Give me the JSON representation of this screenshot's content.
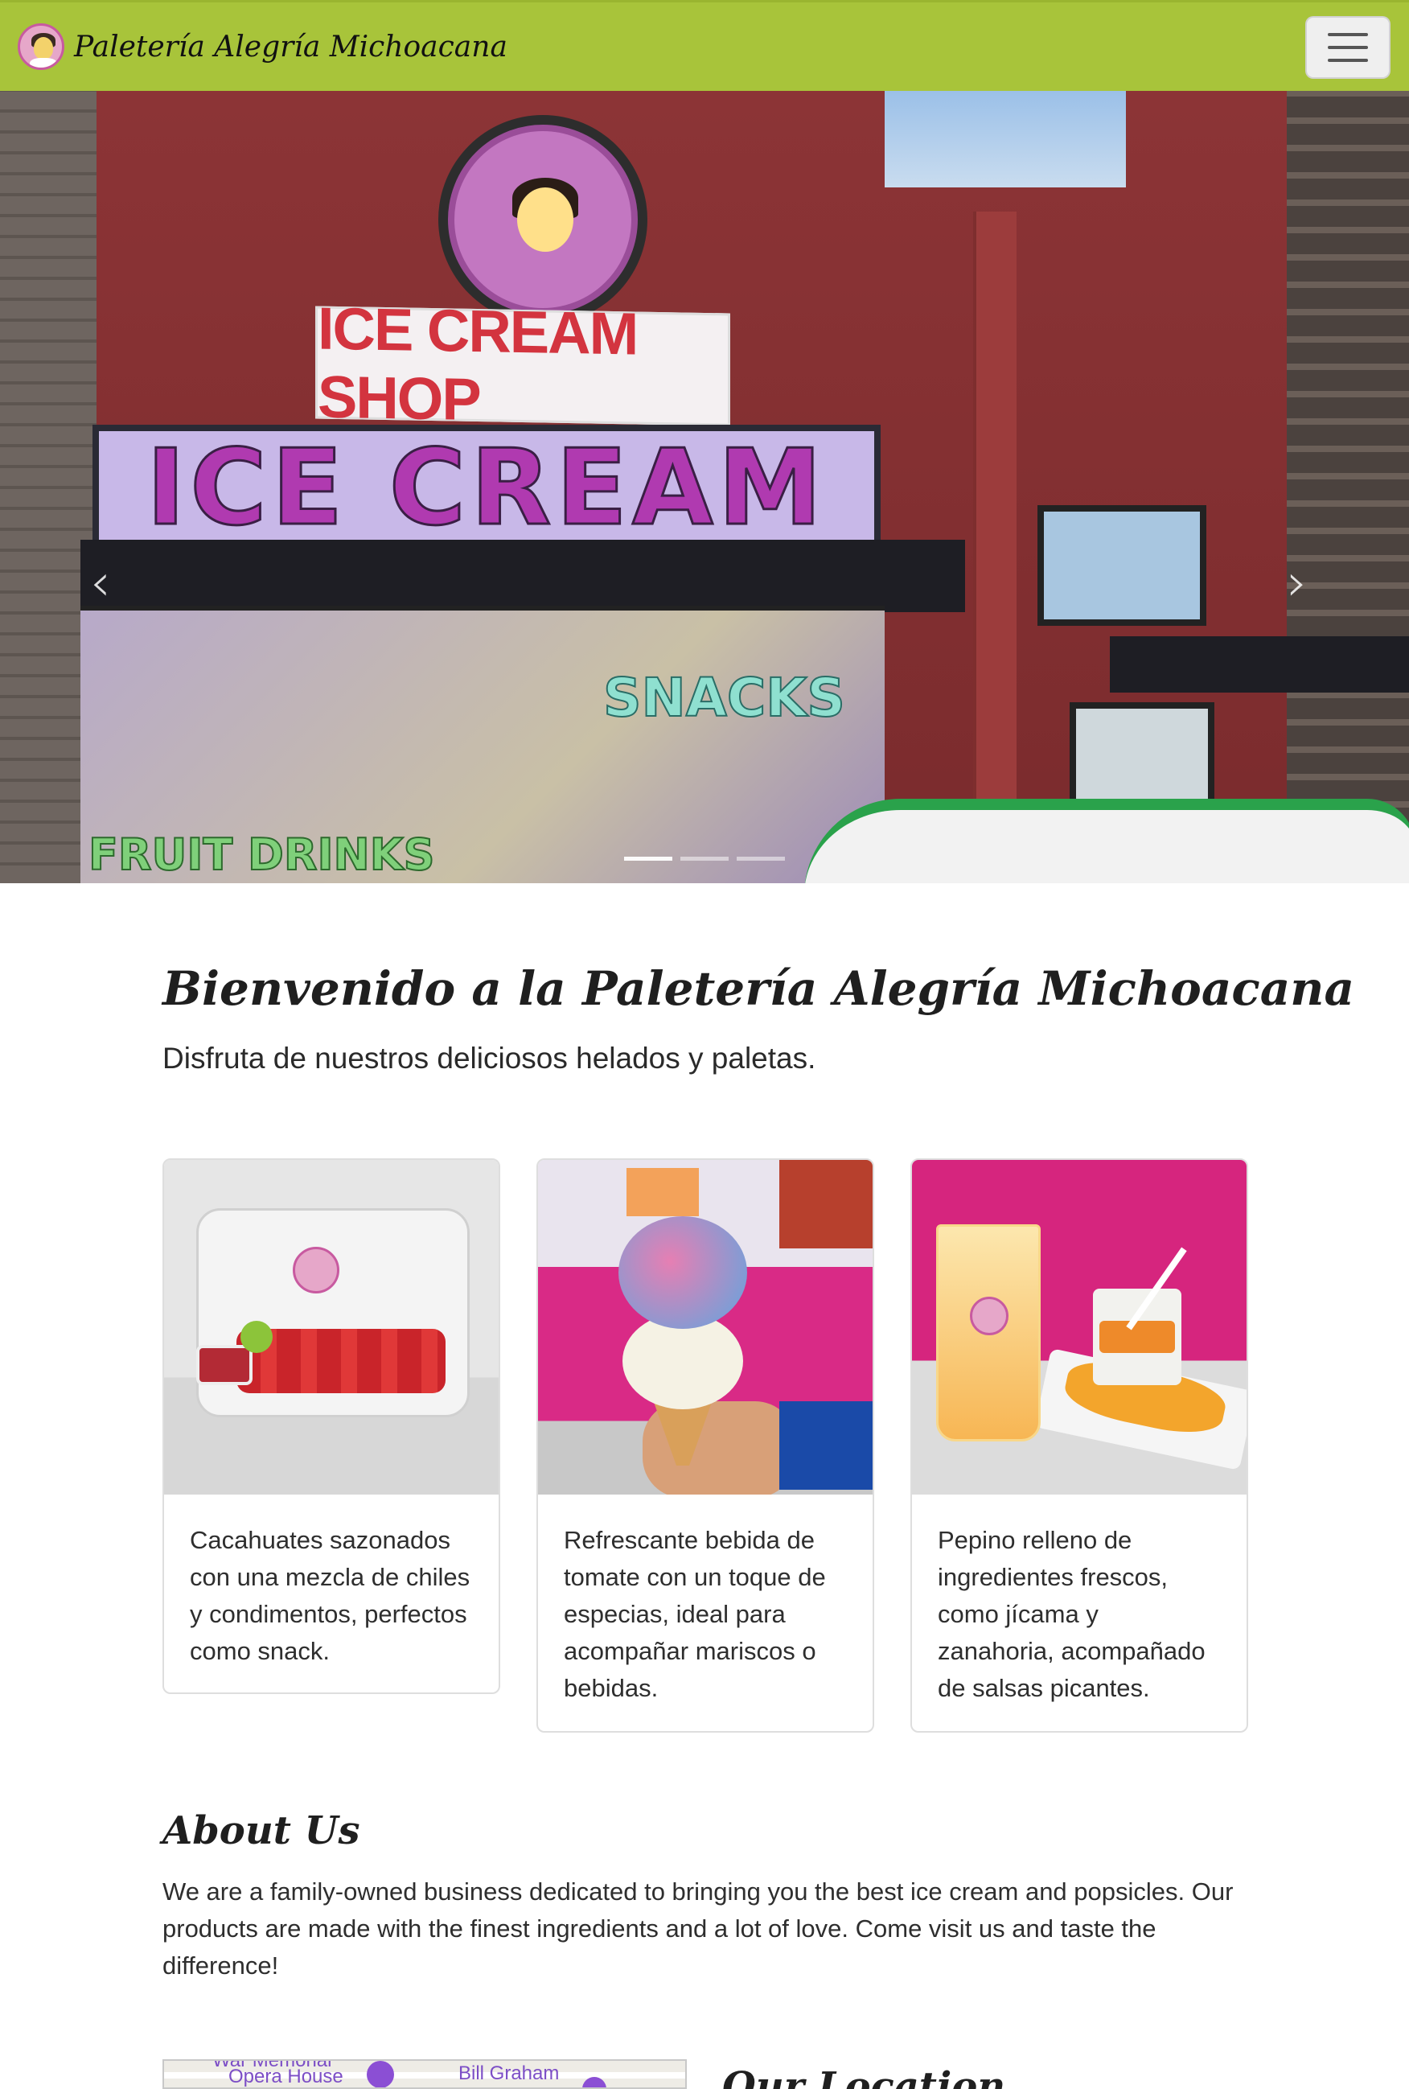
{
  "navbar": {
    "brand": "Paletería Alegría Michoacana",
    "logo_icon": "paleteria-logo-icon",
    "toggler_icon": "hamburger-menu-icon",
    "background": "#a8c43a"
  },
  "hero": {
    "signs": {
      "banner": "ICE CREAM SHOP",
      "main": "ICE CREAM",
      "window_left": "FRUIT DRINKS",
      "window_right": "SNACKS"
    },
    "prev_icon": "chevron-left-icon",
    "next_icon": "chevron-right-icon",
    "prev_glyph": "‹",
    "next_glyph": "›"
  },
  "welcome": {
    "title": "Bienvenido a la Paletería Alegría Michoacana",
    "subtitle": "Disfruta de nuestros deliciosos helados y paletas."
  },
  "cards": [
    {
      "text": "Cacahuates sazonados con una mezcla de chiles y condimentos, perfectos como snack."
    },
    {
      "text": "Refrescante bebida de tomate con un toque de especias, ideal para acompañar mariscos o bebidas."
    },
    {
      "text": "Pepino relleno de ingredientes frescos, como jícama y zanahoria, acompañado de salsas picantes."
    }
  ],
  "about": {
    "title": "About Us",
    "text": "We are a family-owned business dedicated to bringing you the best ice cream and popsicles. Our products are made with the finest ingredients and a lot of love. Come visit us and taste the difference!"
  },
  "location": {
    "title": "Our Location",
    "map_labels": [
      "War Memorial",
      "Opera House",
      "Bill Graham"
    ]
  },
  "colors": {
    "navbar": "#a8c43a",
    "accent_pink": "#d6257e",
    "map_pin": "#8b4fd4"
  }
}
